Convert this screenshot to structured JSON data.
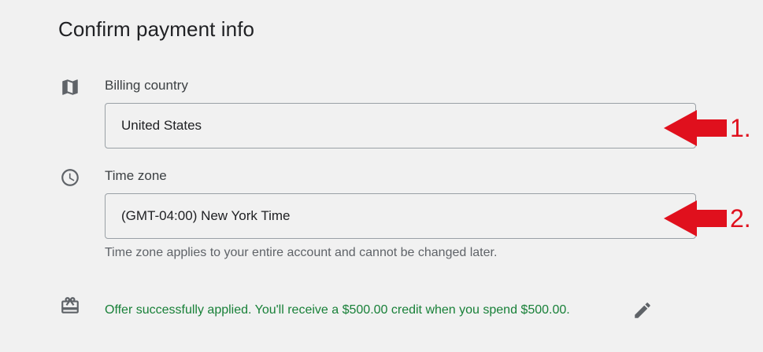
{
  "page": {
    "title": "Confirm payment info"
  },
  "billing_country": {
    "label": "Billing country",
    "value": "United States",
    "icon": "map-icon"
  },
  "time_zone": {
    "label": "Time zone",
    "value": "(GMT-04:00) New York Time",
    "helper": "Time zone applies to your entire account and cannot be changed later.",
    "icon": "clock-icon"
  },
  "offer": {
    "text": "Offer successfully applied. You'll receive a $500.00 credit when you spend $500.00.",
    "icon": "gift-card-icon",
    "edit_icon": "pencil-icon",
    "color": "#188038"
  },
  "annotations": {
    "arrow_1_label": "1.",
    "arrow_2_label": "2.",
    "arrow_color": "#e0101d"
  }
}
